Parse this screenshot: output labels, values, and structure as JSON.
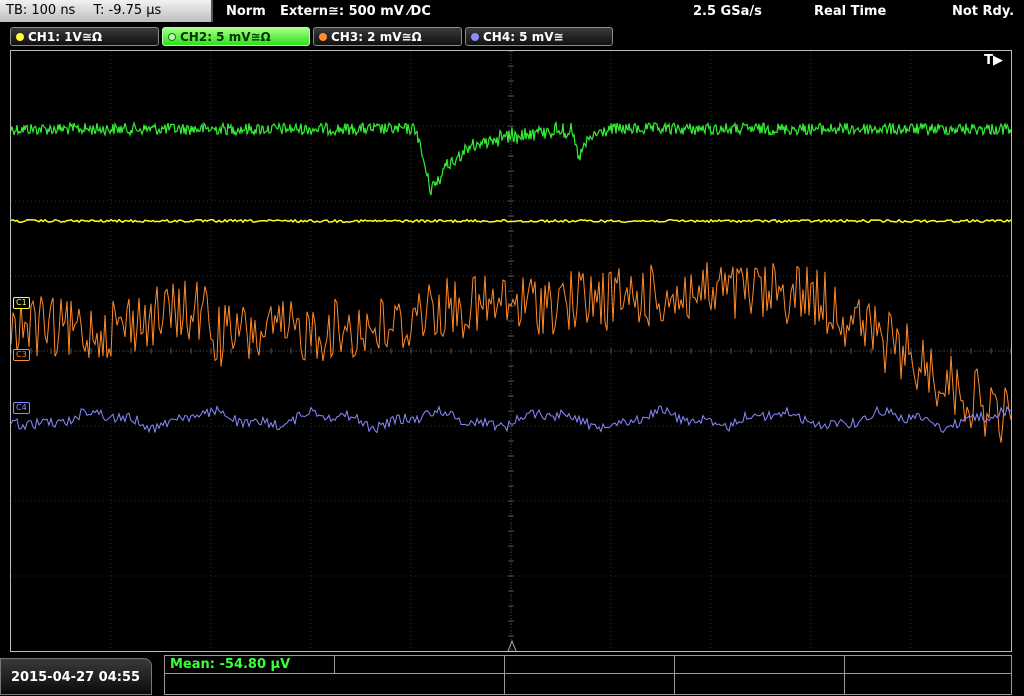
{
  "topbar": {
    "timebase": "TB: 100 ns",
    "trigger_time": "T: -9.75 µs",
    "trigger_mode": "Norm",
    "trigger_source": "Extern≅: 500 mV ⁄DC",
    "sample_rate": "2.5 GSa/s",
    "acq_mode": "Real Time",
    "status": "Not Rdy."
  },
  "channels": [
    {
      "label": "CH1: 1V≅Ω",
      "color": "#ffff33",
      "active": false
    },
    {
      "label": "CH2: 5 mV≅Ω",
      "color": "#33ff33",
      "active": true
    },
    {
      "label": "CH3: 2 mV≅Ω",
      "color": "#ff8c2e",
      "active": false
    },
    {
      "label": "CH4: 5 mV≅",
      "color": "#8c8cff",
      "active": false
    }
  ],
  "screen": {
    "trigger_marker": "T▶",
    "markers": {
      "c1": "C1",
      "c3": "C3",
      "c4": "C4"
    }
  },
  "bottombar": {
    "datetime": "2015-04-27 04:55",
    "measurement": "Mean: -54.80 µV"
  }
}
